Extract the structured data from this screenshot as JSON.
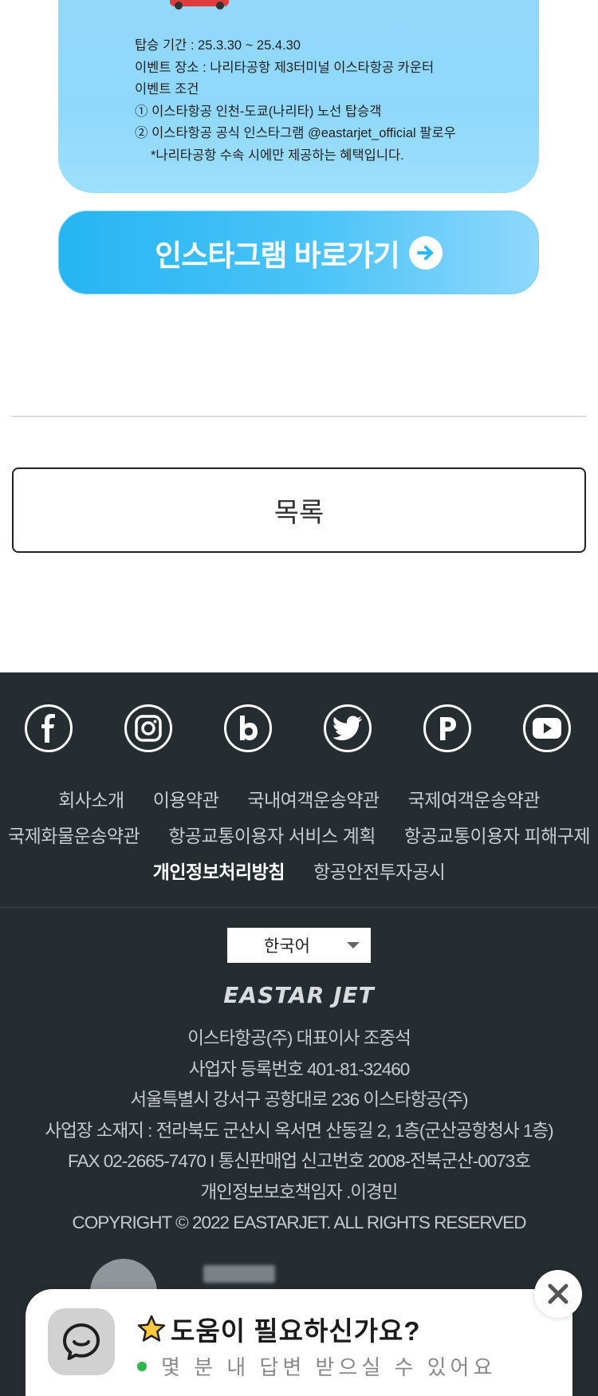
{
  "event": {
    "lines": [
      "탑승 기간 : 25.3.30 ~ 25.4.30",
      "이벤트 장소 : 나리타공항 제3터미널 이스타항공 카운터",
      "이벤트 조건",
      "① 이스타항공 인천-도쿄(나리타) 노선 탑승객",
      "② 이스타항공 공식 인스타그램 @eastarjet_official 팔로우",
      "*나리타공항 수속 시에만 제공하는 혜택입니다."
    ],
    "instagram_button_label": "인스타그램 바로가기"
  },
  "list_button_label": "목록",
  "footer": {
    "social_icons": [
      "facebook-icon",
      "instagram-icon",
      "blog-icon",
      "twitter-icon",
      "post-icon",
      "youtube-icon"
    ],
    "links": {
      "row1": [
        "회사소개",
        "이용약관",
        "국내여객운송약관",
        "국제여객운송약관"
      ],
      "row2": [
        "국제화물운송약관",
        "항공교통이용자 서비스 계획",
        "항공교통이용자 피해구제"
      ],
      "row3": [
        "개인정보처리방침",
        "항공안전투자공시"
      ]
    },
    "language": "한국어",
    "logo_text": "EASTAR JET",
    "company_info": [
      "이스타항공(주) 대표이사 조중석",
      "사업자 등록번호 401-81-32460",
      "서울특별시 강서구 공항대로 236 이스타항공(주)",
      "사업장 소재지 : 전라북도 군산시 옥서면 산동길 2, 1층(군산공항청사 1층)",
      "FAX 02-2665-7470 I 통신판매업 신고번호 2008-전북군산-0073호",
      "개인정보보호책임자 .이경민",
      "COPYRIGHT © 2022 EASTARJET. ALL RIGHTS RESERVED"
    ]
  },
  "chat": {
    "title": "도움이 필요하신가요?",
    "subtitle": "몇 분 내 답변 받으실 수 있어요",
    "status_color": "#2fb34a"
  },
  "colors": {
    "footer_bg": "#262d30",
    "banner_blue": "#25b5f3"
  }
}
